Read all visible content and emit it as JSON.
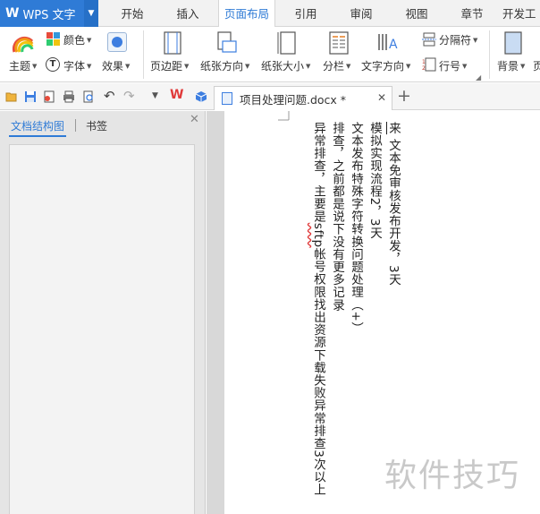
{
  "app": {
    "logo": "W",
    "name": "WPS 文字"
  },
  "tabs": [
    "开始",
    "插入",
    "页面布局",
    "引用",
    "审阅",
    "视图",
    "章节",
    "开发工"
  ],
  "ribbon": {
    "theme": "主题",
    "colors": "颜色",
    "font": "字体",
    "effects": "效果",
    "margins": "页边距",
    "orientation": "纸张方向",
    "size": "纸张大小",
    "columns": "分栏",
    "text_direction": "文字方向",
    "breaks": "分隔符",
    "line_numbers": "行号",
    "background": "背景",
    "more": "页"
  },
  "document": {
    "tab_title": "项目处理问题.docx *"
  },
  "panel": {
    "tab_outline": "文档结构图",
    "tab_bookmarks": "书签"
  },
  "content": {
    "col1_underlined": "来",
    "col1_rest": "  文本免审核发布开发，3天",
    "col2": "模拟实现流程2，3天",
    "col3": "文本发布特殊字符转换问题处理（+）",
    "col4": "排查，之前都是说下没有更多记录",
    "col5_a": "异常排查，主要是",
    "col5_sftp": "sftp",
    "col5_b": "帐号权限找出资源下载失败异常排查3次以上"
  },
  "watermark": "软件技巧",
  "colors": {
    "accent": "#2f7bd6"
  }
}
